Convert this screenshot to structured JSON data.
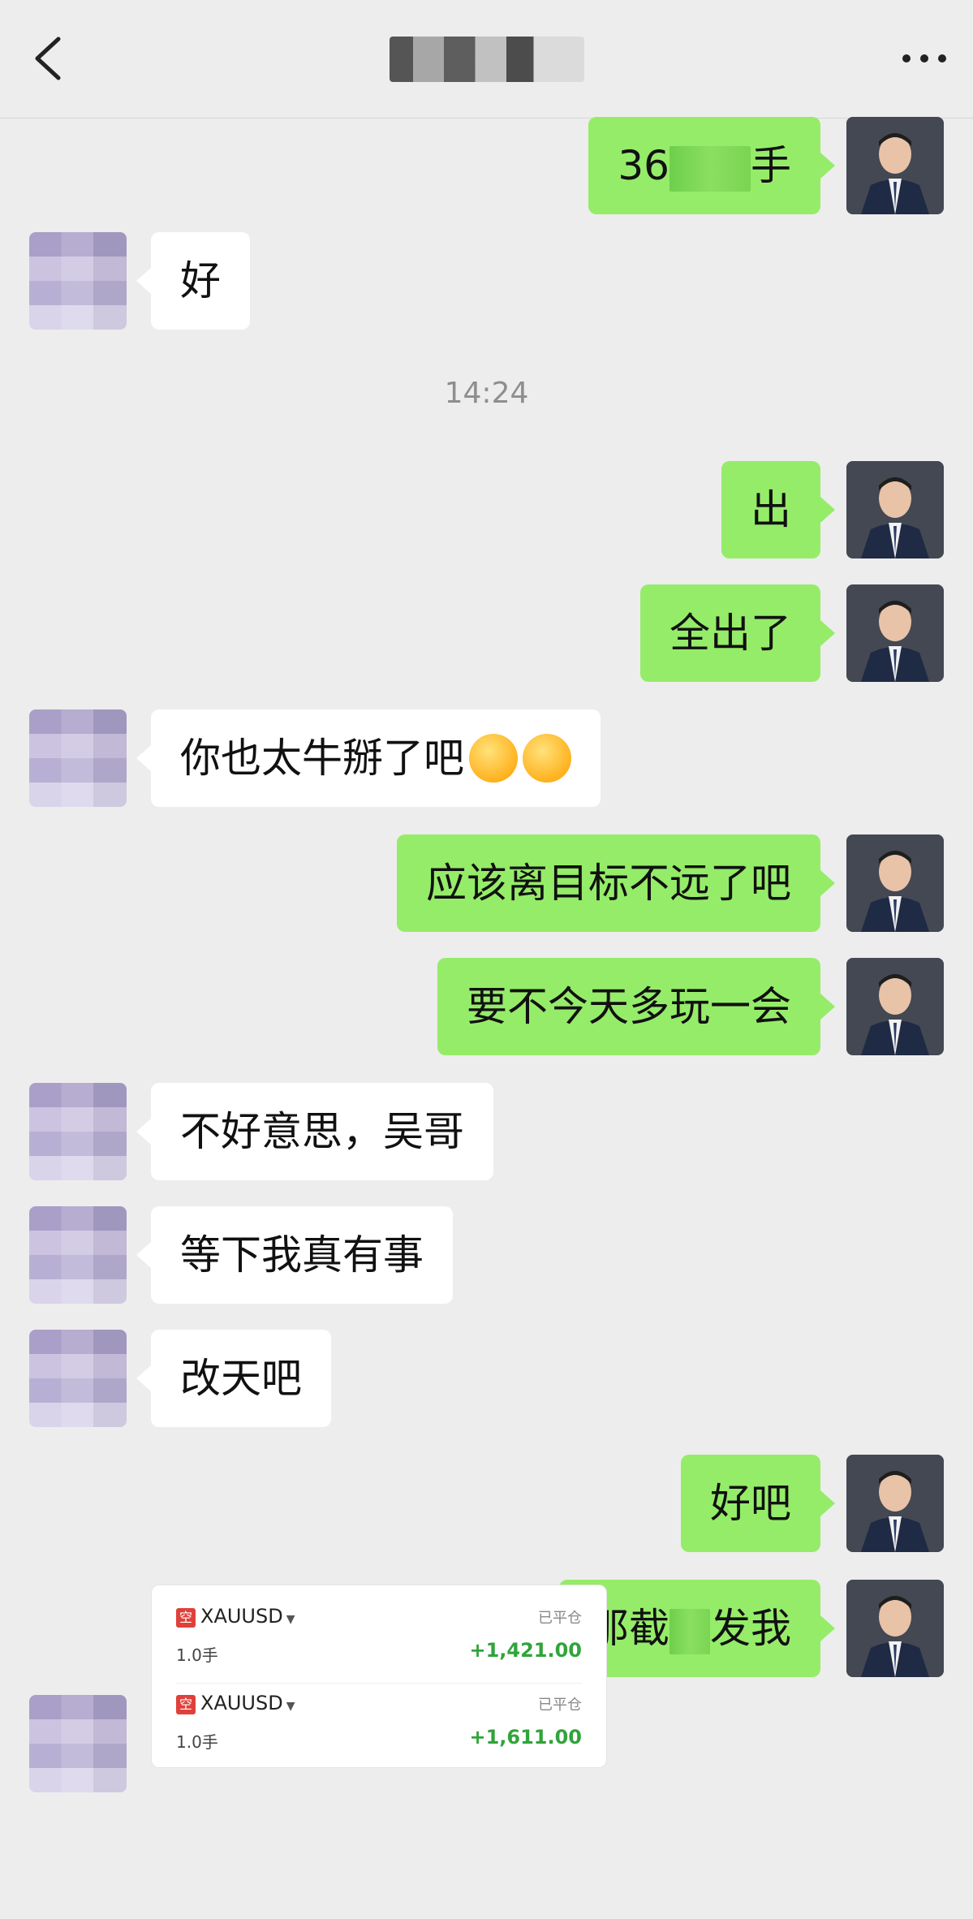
{
  "header": {
    "back_icon": "chevron-left-icon",
    "title_redacted": true,
    "more_icon": "more-horizontal-icon"
  },
  "messages": [
    {
      "side": "out",
      "text_prefix": "36",
      "text_suffix": "手",
      "redacted_middle": true
    },
    {
      "side": "in",
      "text": "好"
    },
    {
      "type": "time",
      "text": "14:24"
    },
    {
      "side": "out",
      "text": "出"
    },
    {
      "side": "out",
      "text": "全出了"
    },
    {
      "side": "in",
      "text": "你也太牛掰了吧",
      "emoji": "hand-over-mouth-emoji",
      "emoji_count": 2
    },
    {
      "side": "out",
      "text": "应该离目标不远了吧"
    },
    {
      "side": "out",
      "text": "要不今天多玩一会"
    },
    {
      "side": "in",
      "text": "不好意思，吴哥"
    },
    {
      "side": "in",
      "text": "等下我真有事"
    },
    {
      "side": "in",
      "text": "改天吧"
    },
    {
      "side": "out",
      "text": "好吧"
    },
    {
      "side": "out",
      "text_prefix": "那截",
      "text_suffix": "发我",
      "redacted_middle": true
    }
  ],
  "trade_card": {
    "rows": [
      {
        "tag": "空",
        "symbol": "XAUUSD",
        "lots": "1.0手",
        "status": "已平仓",
        "pnl": "+1,421.00"
      },
      {
        "tag": "空",
        "symbol": "XAUUSD",
        "lots": "1.0手",
        "status": "已平仓",
        "pnl": "+1,611.00"
      }
    ]
  },
  "colors": {
    "background": "#ededed",
    "outgoing_bubble": "#95ec69",
    "incoming_bubble": "#ffffff",
    "profit": "#31a43a",
    "short_tag": "#e0403a"
  }
}
